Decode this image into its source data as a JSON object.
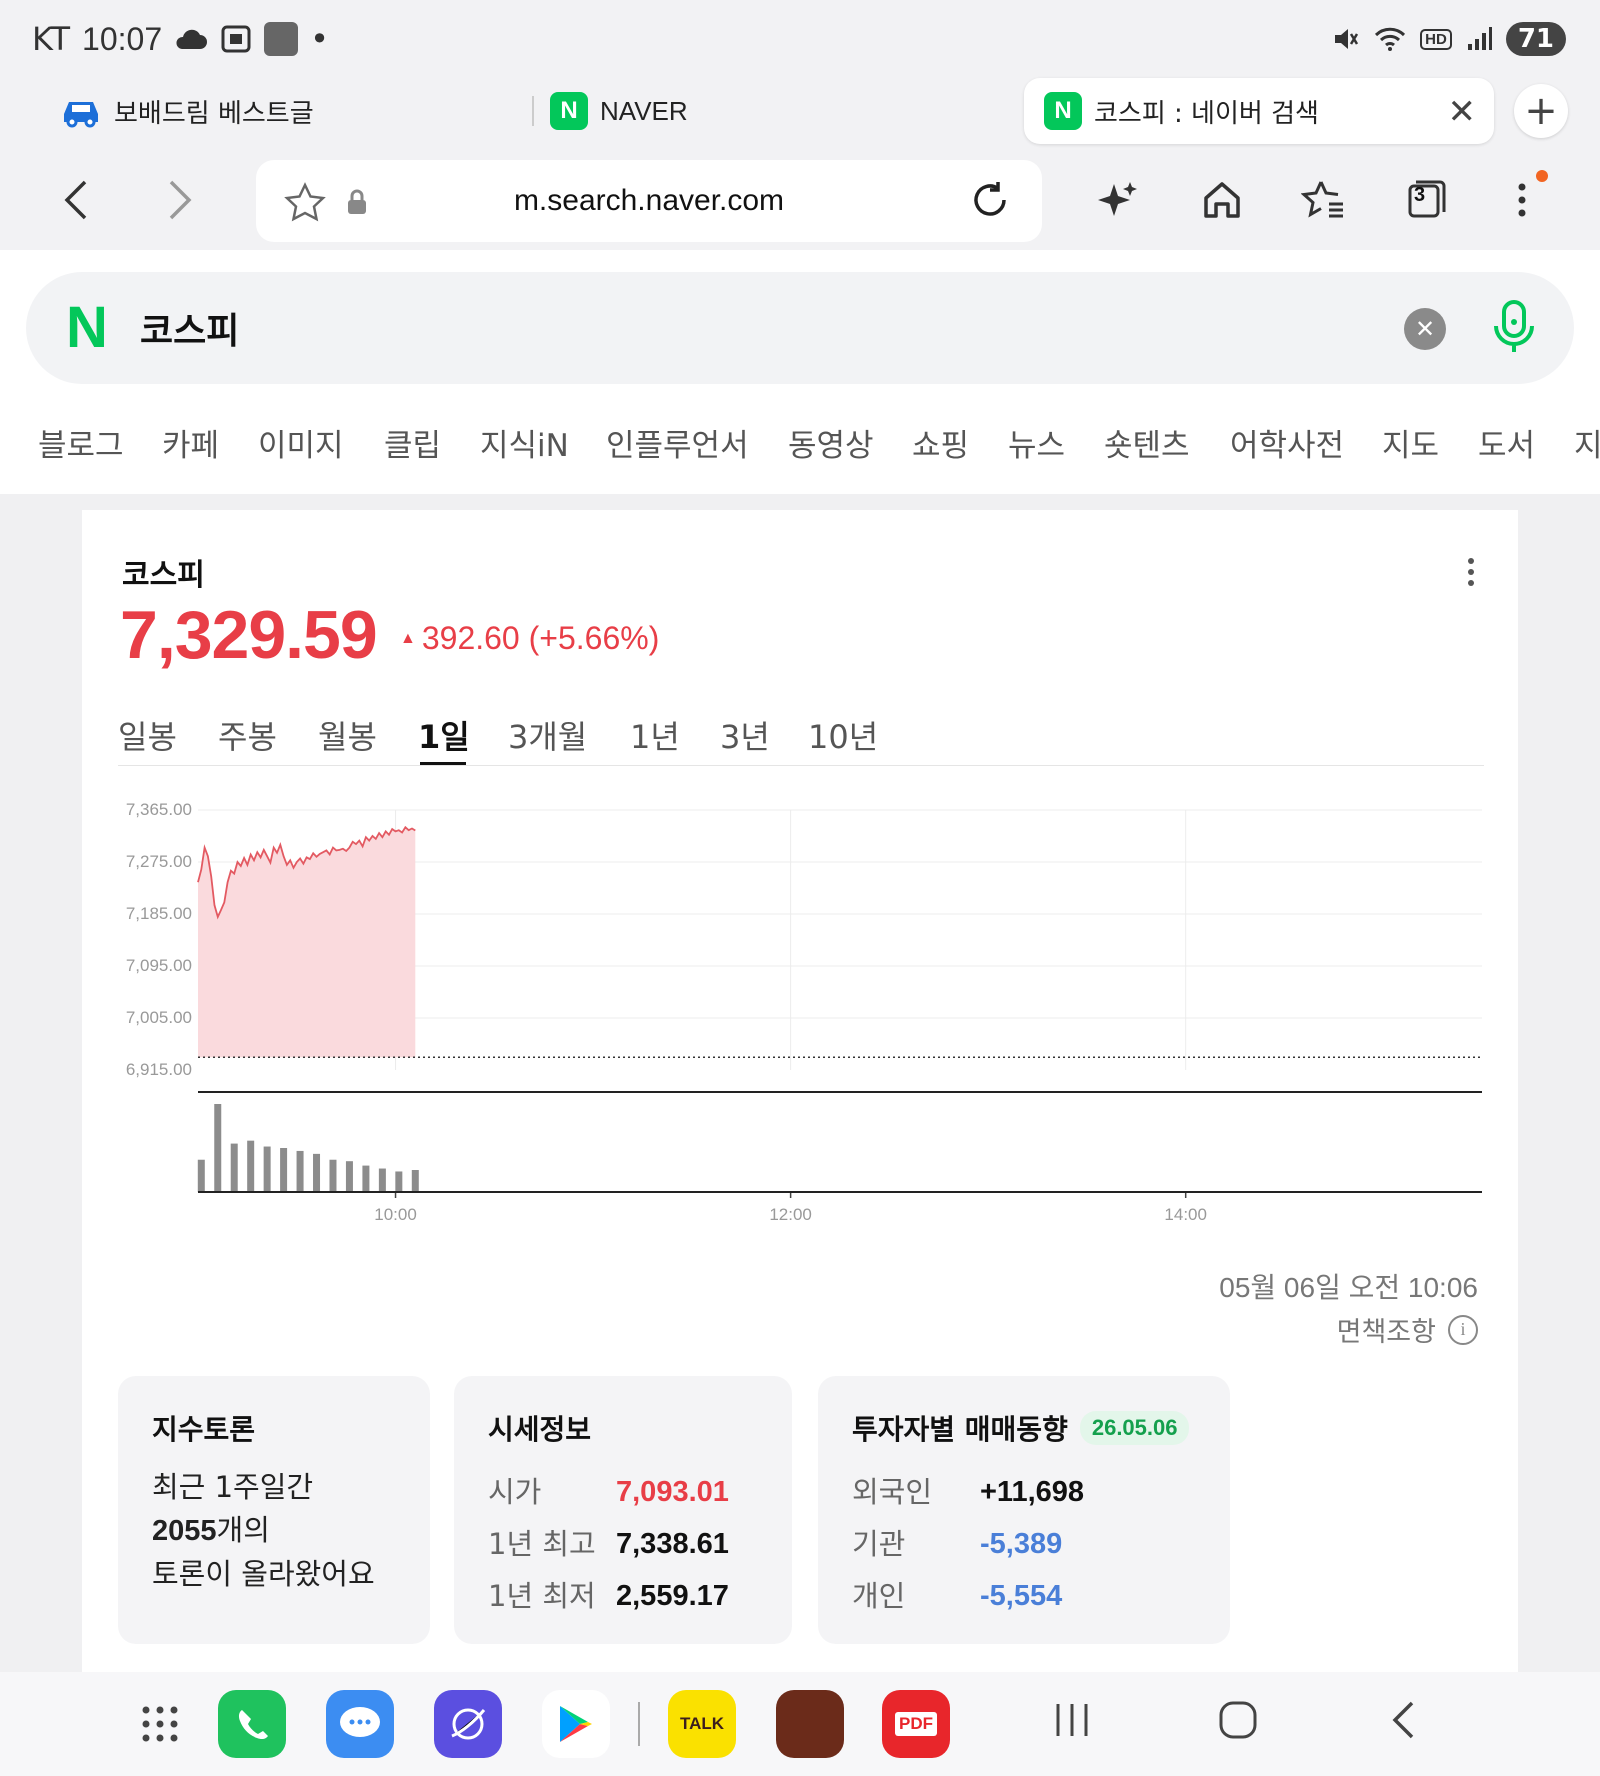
{
  "status": {
    "carrier": "KT",
    "time": "10:07",
    "battery": "71",
    "dot": "•"
  },
  "tabs": [
    {
      "title": "보배드림 베스트글",
      "icon": "car-icon"
    },
    {
      "title": "NAVER",
      "badge": "N"
    },
    {
      "title": "코스피 : 네이버 검색",
      "badge": "N",
      "active": true
    }
  ],
  "toolbar": {
    "url": "m.search.naver.com",
    "tab_count": "3"
  },
  "search": {
    "logo": "N",
    "query": "코스피"
  },
  "verticals": [
    "블로그",
    "카페",
    "이미지",
    "클립",
    "지식iN",
    "인플루언서",
    "동영상",
    "쇼핑",
    "뉴스",
    "숏텐츠",
    "어학사전",
    "지도",
    "도서",
    "지"
  ],
  "index": {
    "name": "코스피",
    "price": "7,329.59",
    "change": "392.60 (+5.66%)",
    "periods": [
      "일봉",
      "주봉",
      "월봉",
      "1일",
      "3개월",
      "1년",
      "3년",
      "10년"
    ],
    "selected_period": "1일",
    "timestamp": "05월 06일 오전 10:06",
    "disclaimer": "면책조항"
  },
  "chart_data": {
    "type": "area",
    "y_ticks": [
      "7,365.00",
      "7,275.00",
      "7,185.00",
      "7,095.00",
      "7,005.00",
      "6,915.00"
    ],
    "x_ticks": [
      "10:00",
      "12:00",
      "14:00"
    ],
    "ylim": [
      6915,
      7365
    ],
    "xlim_minutes": [
      540,
      930
    ],
    "prev_close": 6936.99,
    "x_minutes": [
      540,
      541,
      542,
      543,
      544,
      545,
      546,
      547,
      548,
      549,
      550,
      551,
      552,
      553,
      554,
      555,
      556,
      557,
      558,
      559,
      560,
      561,
      562,
      563,
      564,
      565,
      566,
      567,
      568,
      569,
      570,
      571,
      572,
      573,
      574,
      575,
      576,
      577,
      578,
      579,
      580,
      581,
      582,
      583,
      584,
      585,
      586,
      587,
      588,
      589,
      590,
      591,
      592,
      593,
      594,
      595,
      596,
      597,
      598,
      599,
      600,
      601,
      602,
      603,
      604,
      605,
      606
    ],
    "values": [
      7240,
      7262,
      7300,
      7285,
      7250,
      7200,
      7180,
      7192,
      7205,
      7240,
      7260,
      7255,
      7275,
      7268,
      7282,
      7270,
      7288,
      7278,
      7292,
      7283,
      7296,
      7285,
      7274,
      7300,
      7291,
      7305,
      7285,
      7270,
      7278,
      7265,
      7275,
      7281,
      7272,
      7283,
      7280,
      7290,
      7284,
      7289,
      7292,
      7295,
      7288,
      7300,
      7295,
      7296,
      7298,
      7294,
      7300,
      7310,
      7306,
      7312,
      7302,
      7318,
      7312,
      7320,
      7315,
      7325,
      7318,
      7328,
      7322,
      7332,
      7328,
      7330,
      7326,
      7335,
      7330,
      7333,
      7329.59
    ],
    "volume": {
      "x_minutes": [
        541,
        546,
        551,
        556,
        561,
        566,
        571,
        576,
        581,
        586,
        591,
        596,
        601,
        606
      ],
      "values": [
        22,
        60,
        33,
        35,
        31,
        30,
        28,
        26,
        22,
        21,
        18,
        16,
        14,
        15
      ]
    }
  },
  "discussion": {
    "title": "지수토론",
    "line1": "최근 1주일간",
    "count": "2055",
    "count_suffix": "개의",
    "line3": "토론이 올라왔어요"
  },
  "quote": {
    "title": "시세정보",
    "rows": [
      {
        "label": "시가",
        "value": "7,093.01"
      },
      {
        "label": "1년 최고",
        "value": "7,338.61"
      },
      {
        "label": "1년 최저",
        "value": "2,559.17"
      }
    ]
  },
  "investors": {
    "title": "투자자별 매매동향",
    "date": "26.05.06",
    "rows": [
      {
        "label": "외국인",
        "value": "+11,698"
      },
      {
        "label": "기관",
        "value": "-5,389"
      },
      {
        "label": "개인",
        "value": "-5,554"
      }
    ]
  },
  "dock": {
    "talk": "TALK",
    "pdf": "PDF"
  },
  "colors": {
    "up": "#e83e47",
    "down": "#4a7fd8",
    "naver_green": "#03c75a",
    "area_fill": "#fadadd",
    "line": "#e35a62"
  }
}
